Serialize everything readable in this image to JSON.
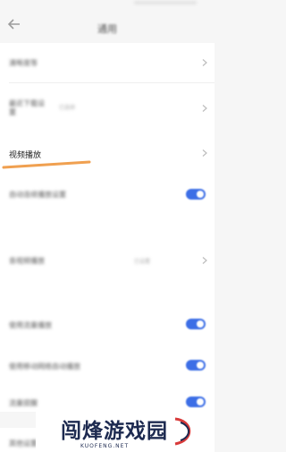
{
  "status_bar": {
    "info": ""
  },
  "nav": {
    "title": "通用"
  },
  "rows": [
    {
      "id": "row-1",
      "label": "清晰度等",
      "value": ""
    },
    {
      "id": "row-2",
      "label": "最近下载设置",
      "value": "已选择"
    },
    {
      "id": "video-playback",
      "label": "视频播放",
      "value": ""
    },
    {
      "id": "row-4",
      "label": "自动连续播放设置",
      "toggle": true
    },
    {
      "id": "row-5",
      "label": "音视频播放",
      "value": "已设置"
    },
    {
      "id": "row-6",
      "label": "使用流量播放",
      "toggle": true
    },
    {
      "id": "row-7",
      "label": "使用移动网络自动播放",
      "toggle": true
    },
    {
      "id": "row-8",
      "label": "流量提醒",
      "toggle": true
    },
    {
      "id": "row-9",
      "label": "其他设置",
      "value": ""
    }
  ],
  "colors": {
    "accent": "#3c6ee6",
    "highlight": "#f0a050"
  },
  "watermark": {
    "brand": "闯烽游戏园",
    "url": "KUOFENG.NET"
  }
}
